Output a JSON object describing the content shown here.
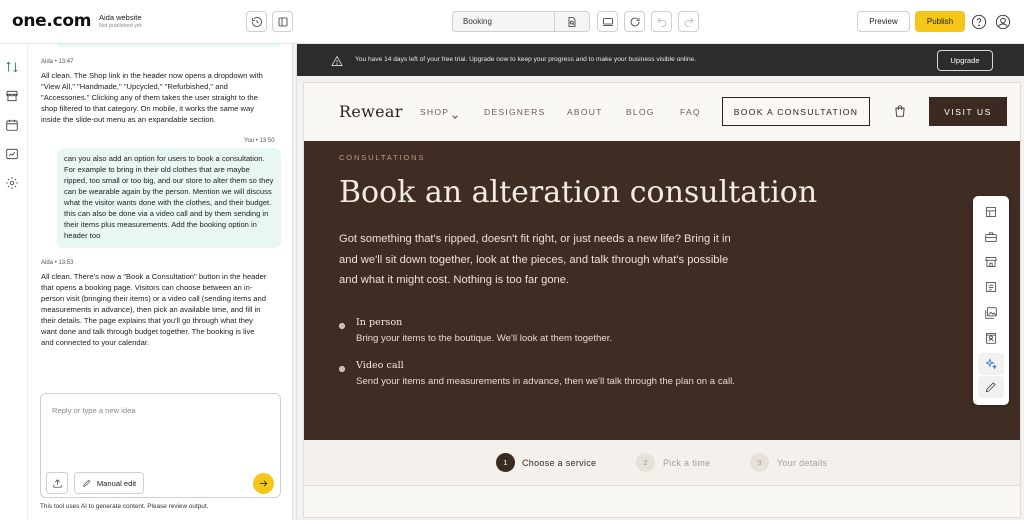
{
  "topbar": {
    "logo": "one.com",
    "site_name": "Aida website",
    "site_status": "Not published yet",
    "page_select": "Booking",
    "preview_label": "Preview",
    "publish_label": "Publish"
  },
  "chat": {
    "messages": [
      {
        "author": "Aida",
        "time": "13:47",
        "text": "All clean. The Shop link in the header now opens a dropdown with \"View All,\" \"Handmade,\" \"Upcycled,\" \"Refurbished,\" and \"Accessories.\" Clicking any of them takes the user straight to the shop filtered to that category. On mobile, it works the same way inside the slide-out menu as an expandable section."
      },
      {
        "author": "You",
        "time": "13:50",
        "text": "can you also add an option for users to book a consultation. For example to bring in their old clothes that are maybe ripped, too small or too big, and our store to alter them so they can be wearable again by the person. Mention we will discuss what the visitor wants done with the clothes, and their budget. this can also be done via a video call and by them sending in their items plus measurements. Add the booking option in header too"
      },
      {
        "author": "Aida",
        "time": "13:53",
        "text": "All clean. There's now a \"Book a Consultation\" button in the header that opens a booking page. Visitors can choose between an in-person visit (bringing their items) or a video call (sending items and measurements in advance), then pick an available time, and fill in their details. The page explains that you'll go through what they want done and talk through budget together. The booking is live and connected to your calendar."
      }
    ],
    "input_placeholder": "Reply or type a new idea",
    "manual_edit_label": "Manual edit",
    "disclaimer": "This tool uses AI to generate content. Please review output."
  },
  "banner": {
    "text": "You have 14 days left of your free trial. Upgrade now to keep your progress and to make your business visible online.",
    "upgrade_label": "Upgrade"
  },
  "site": {
    "logo": "Rewear",
    "nav": {
      "shop": "SHOP",
      "designers": "DESIGNERS",
      "about": "ABOUT",
      "blog": "BLOG",
      "faq": "FAQ"
    },
    "book_label": "BOOK A CONSULTATION",
    "visit_label": "VISIT US",
    "hero": {
      "eyebrow": "CONSULTATIONS",
      "title": "Book an alteration consultation",
      "desc": "Got something that's ripped, doesn't fit right, or just needs a new life? Bring it in and we'll sit down together, look at the pieces, and talk through what's possible and what it might cost. Nothing is too far gone.",
      "options": [
        {
          "title": "In person",
          "desc": "Bring your items to the boutique. We'll look at them together."
        },
        {
          "title": "Video call",
          "desc": "Send your items and measurements in advance, then we'll talk through the plan on a call."
        }
      ]
    },
    "steps": [
      {
        "num": "1",
        "label": "Choose a service"
      },
      {
        "num": "2",
        "label": "Pick a time"
      },
      {
        "num": "3",
        "label": "Your details"
      }
    ]
  }
}
